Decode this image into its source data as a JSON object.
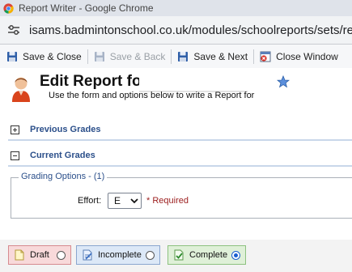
{
  "window": {
    "title": "Report Writer - Google Chrome",
    "url": "isams.badmintonschool.co.uk/modules/schoolreports/sets/repor"
  },
  "toolbar": {
    "save_close": "Save & Close",
    "save_back": "Save & Back",
    "save_next": "Save & Next",
    "close_window": "Close Window"
  },
  "header": {
    "title": "Edit Report for",
    "subtitle": "Use the form and options below to write a Report for"
  },
  "sections": {
    "previous": "Previous Grades",
    "current": "Current Grades"
  },
  "grading": {
    "legend": "Grading Options - (1)",
    "effort_label": "Effort:",
    "effort_value": "E",
    "required": "* Required"
  },
  "status": {
    "options": [
      {
        "label": "Draft",
        "selected": false
      },
      {
        "label": "Incomplete",
        "selected": false
      },
      {
        "label": "Complete",
        "selected": true
      }
    ]
  },
  "colors": {
    "section_label": "#2b4f8a",
    "required": "#9b1c1c",
    "draft_bg": "#f8d9da",
    "incomplete_bg": "#dce8f7",
    "complete_bg": "#dff0d8"
  }
}
